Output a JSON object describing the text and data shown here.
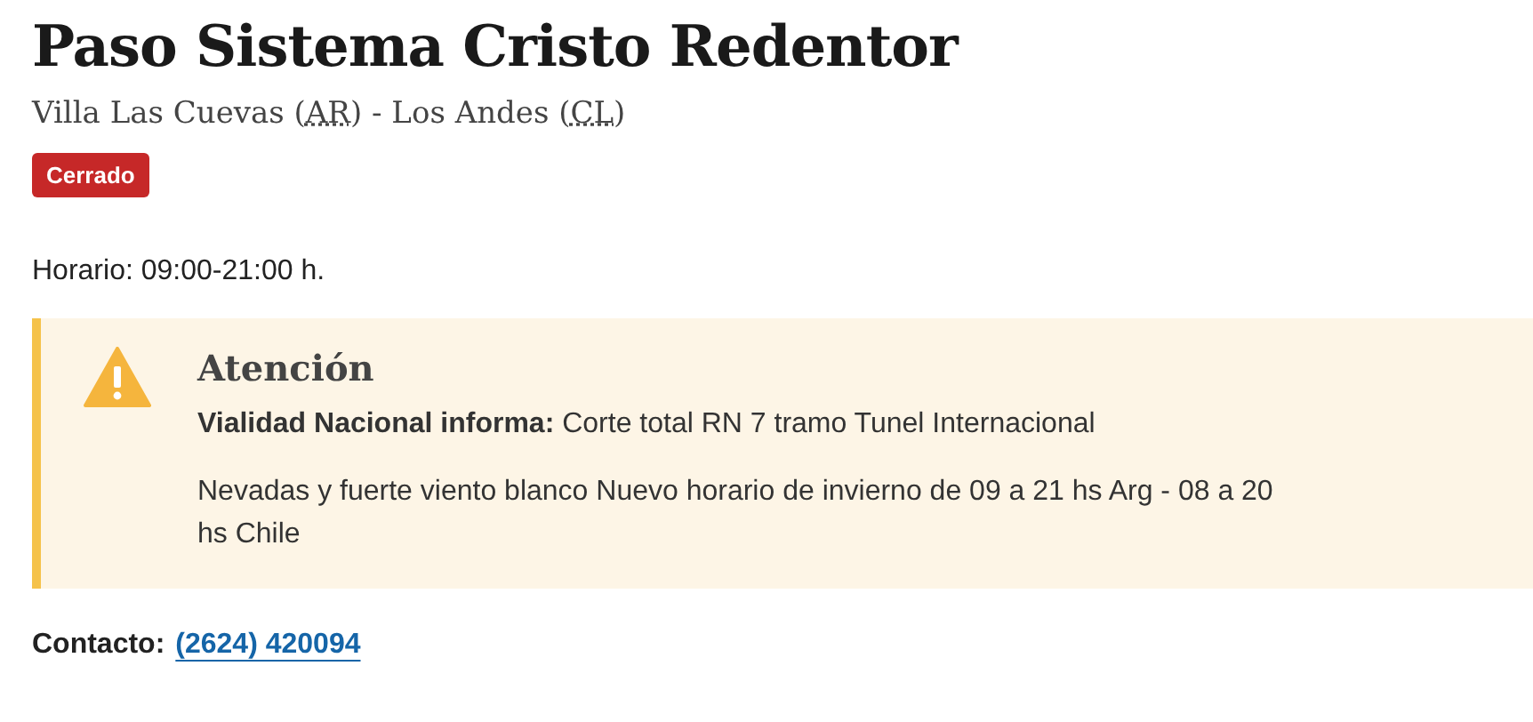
{
  "title": "Paso Sistema Cristo Redentor",
  "subtitle": [
    {
      "text": "Villa Las Cuevas (",
      "abbr": false
    },
    {
      "text": "AR",
      "abbr": true
    },
    {
      "text": ") - Los Andes (",
      "abbr": false
    },
    {
      "text": "CL",
      "abbr": true
    },
    {
      "text": ")",
      "abbr": false
    }
  ],
  "status": {
    "label": "Cerrado",
    "kind": "closed"
  },
  "schedule": "Horario: 09:00-21:00 h.",
  "alert": {
    "kind": "warning",
    "title": "Atención",
    "paragraphs": [
      "**Vialidad Nacional informa:** Corte total RN 7 tramo Tunel Internacional",
      "Nevadas y fuerte viento blanco Nuevo horario de invierno de 09 a 21 hs Arg - 08 a 20 hs Chile"
    ]
  },
  "contact": {
    "label": "Contacto:",
    "phone": "(2624) 420094"
  }
}
